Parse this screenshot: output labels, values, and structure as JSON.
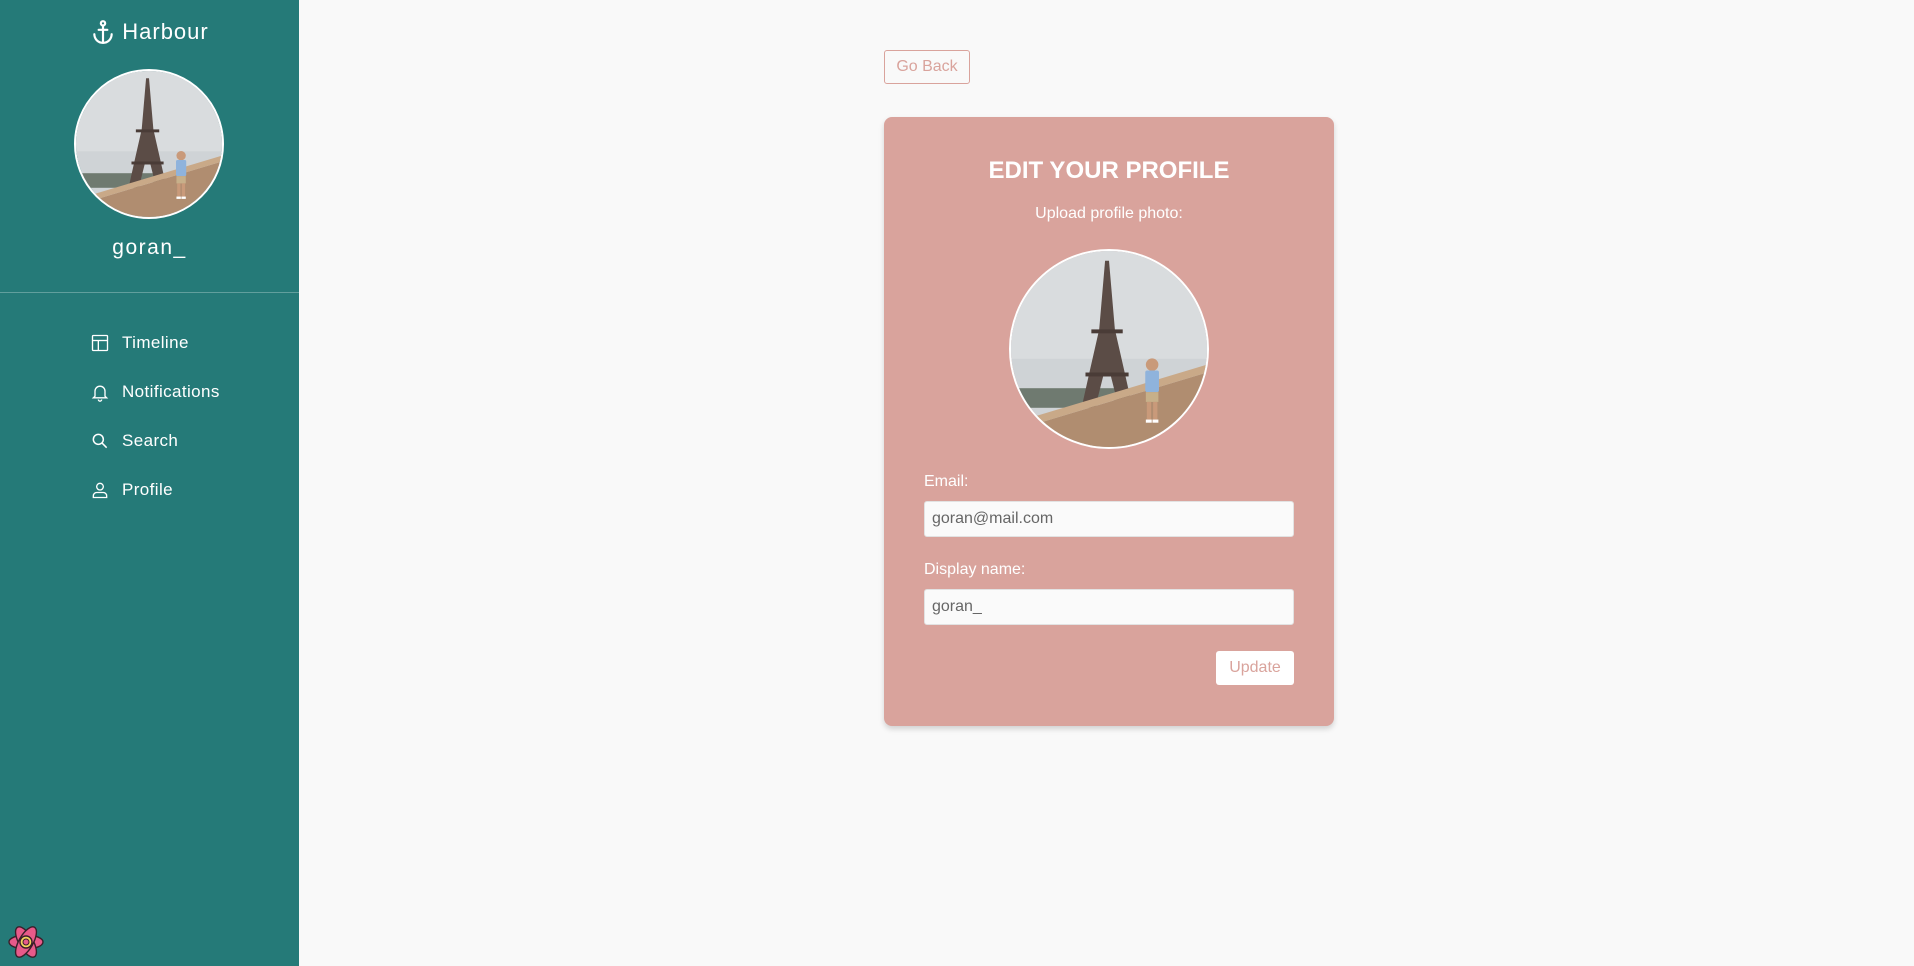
{
  "app": {
    "name": "Harbour",
    "brand_icon": "anchor-icon"
  },
  "user": {
    "username": "goran_"
  },
  "sidebar": {
    "items": [
      {
        "label": "Timeline",
        "icon": "layout-icon"
      },
      {
        "label": "Notifications",
        "icon": "bell-icon"
      },
      {
        "label": "Search",
        "icon": "search-icon"
      },
      {
        "label": "Profile",
        "icon": "user-icon"
      }
    ]
  },
  "page": {
    "back_label": "Go Back",
    "title": "EDIT YOUR PROFILE",
    "upload_label": "Upload profile photo:",
    "email_label": "Email:",
    "email_value": "goran@mail.com",
    "display_name_label": "Display name:",
    "display_name_value": "goran_",
    "update_label": "Update"
  },
  "colors": {
    "sidebar_bg": "#257a78",
    "accent": "#d9a39c",
    "page_bg": "#f9f9f9"
  }
}
